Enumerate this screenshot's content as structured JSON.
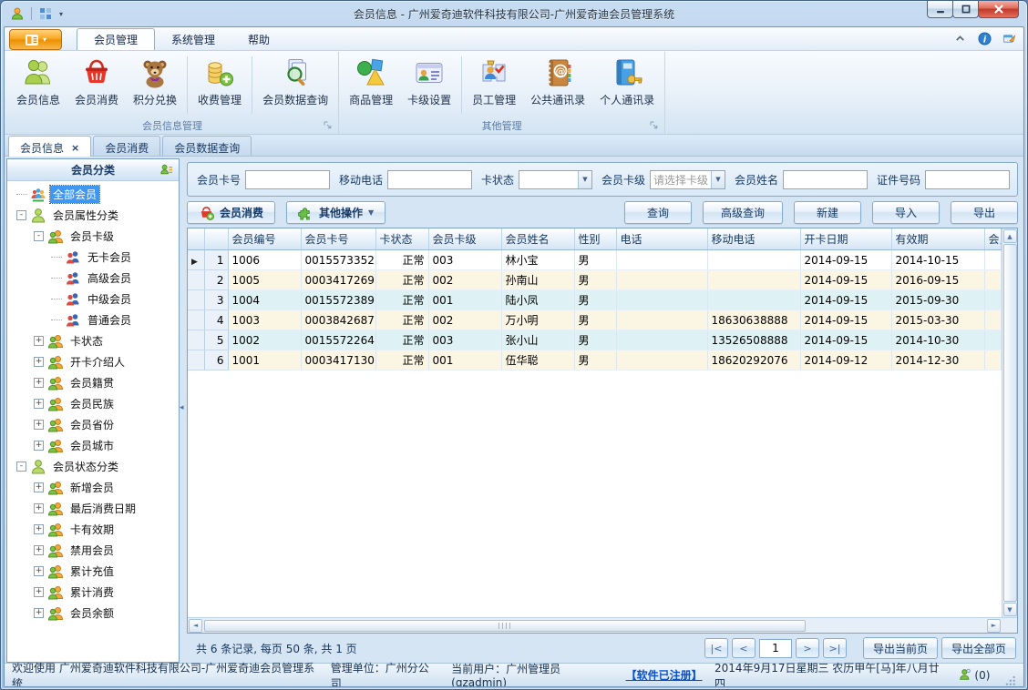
{
  "window": {
    "title": "会员信息 - 广州爱奇迪软件科技有限公司-广州爱奇迪会员管理系统"
  },
  "ribbon": {
    "tabs": [
      {
        "name": "member-management",
        "label": "会员管理",
        "active": true
      },
      {
        "name": "system-management",
        "label": "系统管理",
        "active": false
      },
      {
        "name": "help",
        "label": "帮助",
        "active": false
      }
    ],
    "groups": [
      {
        "name": "member-info-management",
        "label": "会员信息管理",
        "buttons": [
          {
            "name": "member-info",
            "label": "会员信息",
            "icon": "members-icon"
          },
          {
            "name": "member-consume",
            "label": "会员消费",
            "icon": "basket-icon"
          },
          {
            "name": "points-exchange",
            "label": "积分兑换",
            "icon": "teddy-icon"
          },
          {
            "type": "sep"
          },
          {
            "name": "fee-management",
            "label": "收费管理",
            "icon": "coins-icon"
          },
          {
            "type": "sep"
          },
          {
            "name": "member-data-query",
            "label": "会员数据查询",
            "icon": "search-docs-icon"
          }
        ]
      },
      {
        "name": "other-management",
        "label": "其他管理",
        "buttons": [
          {
            "name": "goods-management",
            "label": "商品管理",
            "icon": "shapes-icon"
          },
          {
            "name": "card-level-settings",
            "label": "卡级设置",
            "icon": "card-icon"
          },
          {
            "type": "sep"
          },
          {
            "name": "staff-management",
            "label": "员工管理",
            "icon": "staff-icon"
          },
          {
            "name": "public-contacts",
            "label": "公共通讯录",
            "icon": "address-book-icon"
          },
          {
            "name": "personal-contacts",
            "label": "个人通讯录",
            "icon": "personal-book-icon"
          }
        ]
      }
    ]
  },
  "doc_tabs": [
    {
      "name": "member-info",
      "label": "会员信息",
      "active": true,
      "closable": true
    },
    {
      "name": "member-consume",
      "label": "会员消费",
      "active": false,
      "closable": false
    },
    {
      "name": "member-data-query",
      "label": "会员数据查询",
      "active": false,
      "closable": false
    }
  ],
  "sidebar": {
    "title": "会员分类",
    "tree": [
      {
        "name": "all-members",
        "label": "全部会员",
        "level": 0,
        "expander": "none",
        "icon": "group-icon",
        "selected": true
      },
      {
        "name": "member-attribute-category",
        "label": "会员属性分类",
        "level": 0,
        "expander": "minus",
        "icon": "person-green-icon",
        "selected": false
      },
      {
        "name": "member-card-level",
        "label": "会员卡级",
        "level": 1,
        "expander": "minus",
        "icon": "two-person-icon",
        "selected": false
      },
      {
        "name": "no-card-member",
        "label": "无卡会员",
        "level": 2,
        "expander": "none",
        "icon": "member-pair-icon",
        "selected": false
      },
      {
        "name": "senior-member",
        "label": "高级会员",
        "level": 2,
        "expander": "none",
        "icon": "member-pair-icon",
        "selected": false
      },
      {
        "name": "middle-member",
        "label": "中级会员",
        "level": 2,
        "expander": "none",
        "icon": "member-pair-icon",
        "selected": false
      },
      {
        "name": "normal-member",
        "label": "普通会员",
        "level": 2,
        "expander": "none",
        "icon": "member-pair-icon",
        "selected": false
      },
      {
        "name": "card-status",
        "label": "卡状态",
        "level": 1,
        "expander": "plus",
        "icon": "two-person-icon",
        "selected": false
      },
      {
        "name": "card-introducer",
        "label": "开卡介绍人",
        "level": 1,
        "expander": "plus",
        "icon": "two-person-icon",
        "selected": false
      },
      {
        "name": "member-native-place",
        "label": "会员籍贯",
        "level": 1,
        "expander": "plus",
        "icon": "two-person-icon",
        "selected": false
      },
      {
        "name": "member-ethnicity",
        "label": "会员民族",
        "level": 1,
        "expander": "plus",
        "icon": "two-person-icon",
        "selected": false
      },
      {
        "name": "member-province",
        "label": "会员省份",
        "level": 1,
        "expander": "plus",
        "icon": "two-person-icon",
        "selected": false
      },
      {
        "name": "member-city",
        "label": "会员城市",
        "level": 1,
        "expander": "plus",
        "icon": "two-person-icon",
        "selected": false
      },
      {
        "name": "member-status-category",
        "label": "会员状态分类",
        "level": 0,
        "expander": "minus",
        "icon": "person-green-icon",
        "selected": false
      },
      {
        "name": "new-members",
        "label": "新增会员",
        "level": 1,
        "expander": "plus",
        "icon": "two-person-icon",
        "selected": false
      },
      {
        "name": "last-consume-date",
        "label": "最后消费日期",
        "level": 1,
        "expander": "plus",
        "icon": "two-person-icon",
        "selected": false
      },
      {
        "name": "card-validity",
        "label": "卡有效期",
        "level": 1,
        "expander": "plus",
        "icon": "two-person-icon",
        "selected": false
      },
      {
        "name": "disabled-members",
        "label": "禁用会员",
        "level": 1,
        "expander": "plus",
        "icon": "two-person-icon",
        "selected": false
      },
      {
        "name": "total-recharge",
        "label": "累计充值",
        "level": 1,
        "expander": "plus",
        "icon": "two-person-icon",
        "selected": false
      },
      {
        "name": "total-consume",
        "label": "累计消费",
        "level": 1,
        "expander": "plus",
        "icon": "two-person-icon",
        "selected": false
      },
      {
        "name": "member-balance",
        "label": "会员余额",
        "level": 1,
        "expander": "plus",
        "icon": "two-person-icon",
        "selected": false
      }
    ]
  },
  "filters": [
    {
      "name": "member-card-no",
      "label": "会员卡号",
      "type": "input",
      "value": ""
    },
    {
      "name": "mobile-phone",
      "label": "移动电话",
      "type": "input",
      "value": ""
    },
    {
      "name": "card-status",
      "label": "卡状态",
      "type": "select",
      "value": "",
      "is_placeholder": false
    },
    {
      "name": "member-card-level",
      "label": "会员卡级",
      "type": "select",
      "value": "请选择卡级",
      "is_placeholder": true
    },
    {
      "name": "member-name",
      "label": "会员姓名",
      "type": "input",
      "value": ""
    },
    {
      "name": "id-number",
      "label": "证件号码",
      "type": "input",
      "value": ""
    }
  ],
  "toolbar": {
    "left": [
      {
        "name": "member-consume",
        "label": "会员消费",
        "icon": "basket-plus-icon",
        "dropdown": false
      },
      {
        "name": "other-actions",
        "label": "其他操作",
        "icon": "puzzle-icon",
        "dropdown": true
      }
    ],
    "right": [
      {
        "name": "query",
        "label": "查询",
        "wide": false
      },
      {
        "name": "advanced-query",
        "label": "高级查询",
        "wide": true
      },
      {
        "name": "new",
        "label": "新建",
        "wide": false
      },
      {
        "name": "import",
        "label": "导入",
        "wide": false
      },
      {
        "name": "export",
        "label": "导出",
        "wide": false
      }
    ]
  },
  "table": {
    "columns": [
      "会员编号",
      "会员卡号",
      "卡状态",
      "会员卡级",
      "会员姓名",
      "性别",
      "电话",
      "移动电话",
      "开卡日期",
      "有效期",
      "会员"
    ],
    "rows": [
      {
        "num": "1",
        "current": true,
        "values": [
          "1006",
          "0015573352",
          "正常",
          "003",
          "林小宝",
          "男",
          "",
          "",
          "2014-09-15",
          "2014-10-15",
          ""
        ]
      },
      {
        "num": "2",
        "current": false,
        "values": [
          "1005",
          "0003417269",
          "正常",
          "002",
          "孙南山",
          "男",
          "",
          "",
          "2014-09-15",
          "2016-09-15",
          ""
        ]
      },
      {
        "num": "3",
        "current": false,
        "values": [
          "1004",
          "0015572389",
          "正常",
          "001",
          "陆小凤",
          "男",
          "",
          "",
          "2014-09-15",
          "2015-09-30",
          ""
        ]
      },
      {
        "num": "4",
        "current": false,
        "values": [
          "1003",
          "0003842687",
          "正常",
          "002",
          "万小明",
          "男",
          "",
          "18630638888",
          "2014-09-15",
          "2015-03-30",
          ""
        ]
      },
      {
        "num": "5",
        "current": false,
        "values": [
          "1002",
          "0015572264",
          "正常",
          "003",
          "张小山",
          "男",
          "",
          "13526508888",
          "2014-09-15",
          "2014-10-30",
          ""
        ]
      },
      {
        "num": "6",
        "current": false,
        "values": [
          "1001",
          "0003417130",
          "正常",
          "001",
          "伍华聪",
          "男",
          "",
          "18620292076",
          "2014-09-12",
          "2014-12-30",
          ""
        ]
      }
    ]
  },
  "pagination": {
    "summary": "共 6 条记录, 每页 50 条, 共 1 页",
    "first": "|<",
    "prev": "<",
    "page": "1",
    "next": ">",
    "last": ">|",
    "export_current": "导出当前页",
    "export_all": "导出全部页"
  },
  "statusbar": {
    "welcome": "欢迎使用 广州爱奇迪软件科技有限公司-广州爱奇迪会员管理系统",
    "org": "管理单位：广州分公司",
    "user": "当前用户：广州管理员(gzadmin)",
    "license": "【软件已注册】",
    "date": "2014年9月17日星期三 农历甲午[马]年八月廿四",
    "online_count": "(0)"
  },
  "colors": {
    "accent_orange": "#f6a41f",
    "selection_blue": "#3f97f5",
    "row_cream": "#fbf5e3",
    "row_cyan": "#def2f5",
    "link_blue": "#0a50c8"
  }
}
